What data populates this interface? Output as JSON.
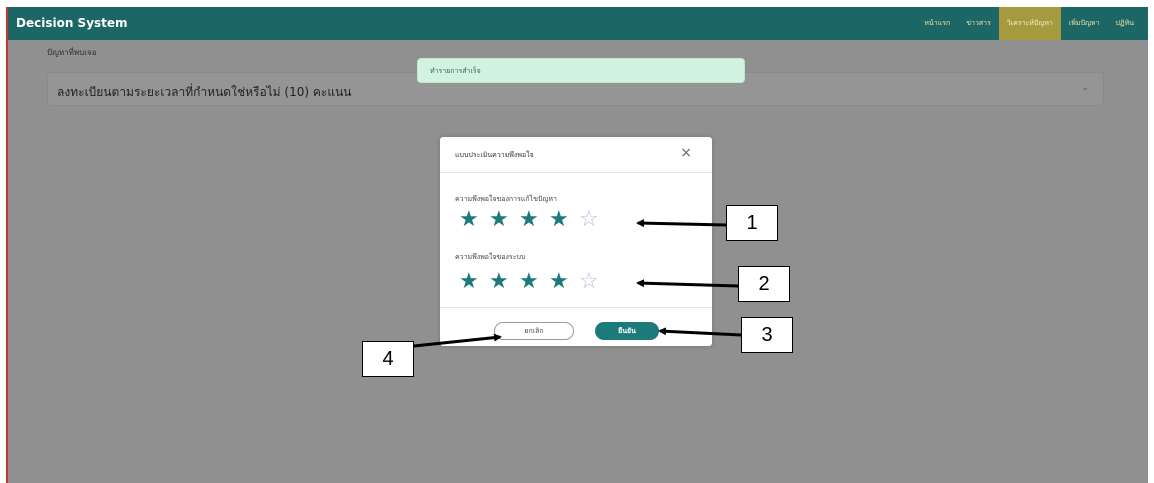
{
  "navbar": {
    "brand": "Decision System",
    "links": [
      {
        "label": "หน้าแรก",
        "active": false
      },
      {
        "label": "ข่าวสาร",
        "active": false
      },
      {
        "label": "วิเคราะห์ปัญหา",
        "active": true
      },
      {
        "label": "เพิ่มปัญหา",
        "active": false
      },
      {
        "label": "ปฏิทิน",
        "active": false
      }
    ]
  },
  "main": {
    "section_label": "ปัญหาที่พบเจอ",
    "accordion_title": "ลงทะเบียนตามระยะเวลาที่กำหนดใช่หรือไม่ (10) คะแนน",
    "accordion_chevron": "⌄"
  },
  "toast": {
    "message": "ทำรายการสำเร็จ"
  },
  "modal": {
    "title": "แบบประเมินความพึงพอใจ",
    "close_glyph": "×",
    "rating_solution": {
      "label": "ความพึงพอใจของการแก้ไขปัญหา",
      "value": 4,
      "max": 5
    },
    "rating_system": {
      "label": "ความพึงพอใจของระบบ",
      "value": 4,
      "max": 5
    },
    "cancel_label": "ยกเลิก",
    "confirm_label": "ยืนยัน"
  },
  "annotations": {
    "labels": [
      "1",
      "2",
      "3",
      "4"
    ]
  },
  "colors": {
    "navbar": "#1d6666",
    "active_tab": "#a69a3f",
    "star_filled": "#1d7a7a",
    "star_empty": "#b9b9d9",
    "confirm_button": "#1d7a7a",
    "toast_bg": "#d2f3df",
    "overlay": "#909090"
  },
  "icons": {
    "star_filled": "star-filled-icon",
    "star_empty": "star-outline-icon",
    "close": "close-icon",
    "chevron": "chevron-down-icon"
  }
}
